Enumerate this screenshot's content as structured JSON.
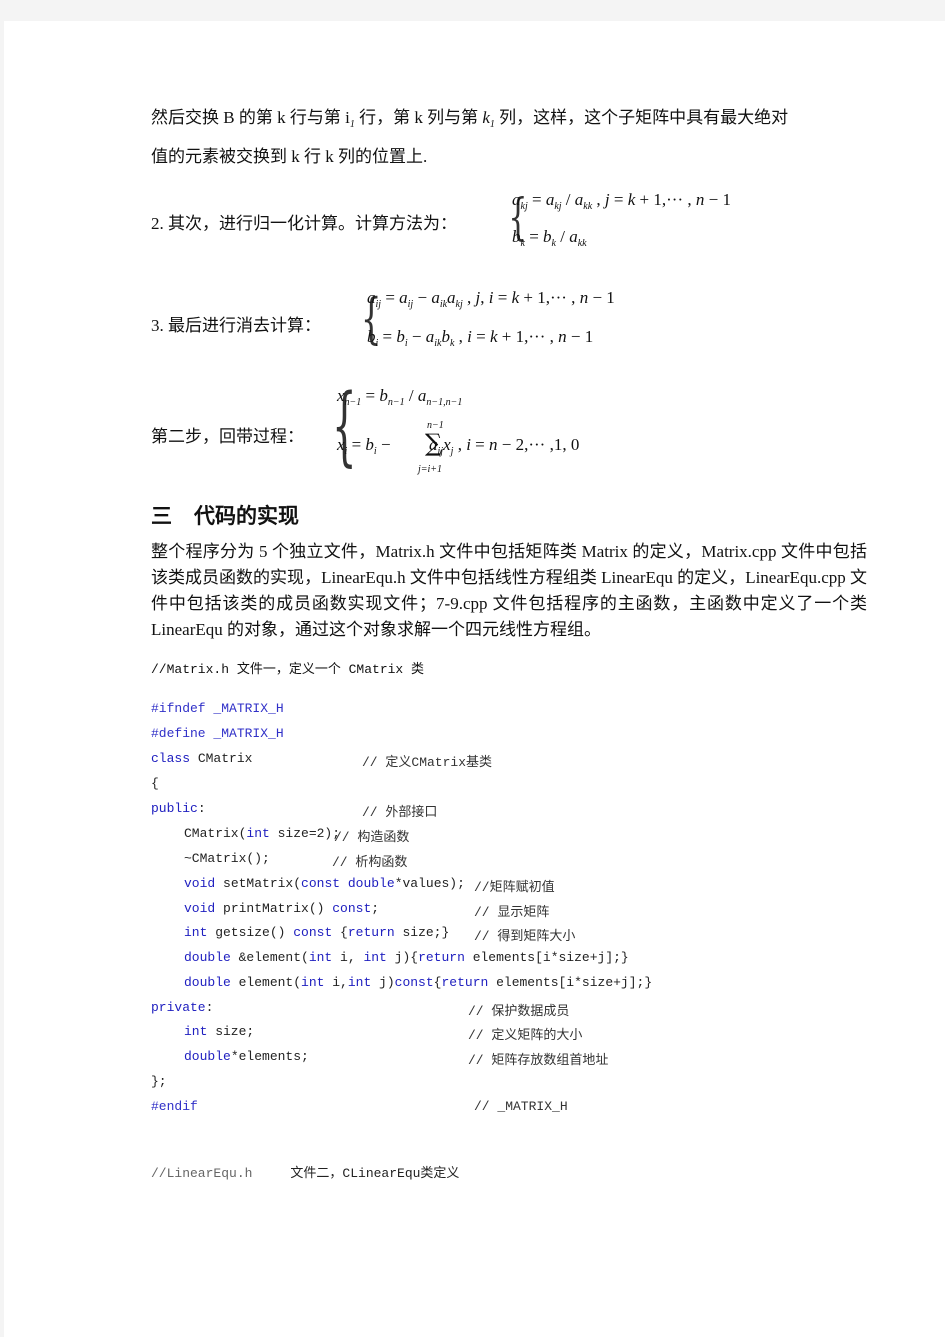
{
  "intro_paragraph": {
    "line1_a": "然后交换 B 的第 k 行与第 ",
    "i1_base": "i",
    "i1_sub": "1",
    "line1_b": " 行，第 k 列与第 ",
    "k1_base": "k",
    "k1_sub": "1",
    "line1_c": " 列，这样，这个子矩阵中具有最大绝对",
    "line2": "值的元素被交换到 k 行 k 列的位置上."
  },
  "step2": {
    "label": "2.  其次，进行归一化计算。计算方法为：",
    "eq1": "a_kj = a_kj / a_kk , j = k + 1,··· , n − 1",
    "eq2": "b_k = b_k / a_kk"
  },
  "step3": {
    "label": "3.  最后进行消去计算：",
    "eq1": "a_ij = a_ij − a_ik a_kj , j, i = k + 1,··· , n − 1",
    "eq2": "b_i = b_i − a_ik b_k , i = k + 1,··· , n − 1"
  },
  "back_substitution": {
    "label": "第二步，回带过程：",
    "eq1": "x_{n−1} = b_{n−1} / a_{n−1,n−1}",
    "eq2": "x_i = b_i − Σ_{j=i+1}^{n−1} a_ij x_j , i = n − 2,··· ,1, 0",
    "sum_upper": "n−1",
    "sum_lower": "j=i+1"
  },
  "section3": {
    "heading_num": "三",
    "heading_text": "代码的实现",
    "paragraph": "整个程序分为 5 个独立文件，Matrix.h 文件中包括矩阵类 Matrix 的定义，Matrix.cpp 文件中包括该类成员函数的实现，LinearEqu.h 文件中包括线性方程组类 LinearEqu 的定义，LinearEqu.cpp 文件中包括该类的成员函数实现文件；7-9.cpp 文件包括程序的主函数，主函数中定义了一个类 LinearEqu 的对象，通过这个对象求解一个四元线性方程组。"
  },
  "code": {
    "file1_header": "//Matrix.h 文件一，定义一个 CMatrix 类",
    "lines": [
      {
        "code": "#ifndef _MATRIX_H",
        "comment": ""
      },
      {
        "code": "#define _MATRIX_H",
        "comment": ""
      },
      {
        "code": "class CMatrix",
        "comment": "// 定义CMatrix基类"
      },
      {
        "code": "{",
        "comment": ""
      },
      {
        "code": "public:",
        "comment": "// 外部接口"
      },
      {
        "code": "CMatrix(int size=2);",
        "comment": "// 构造函数"
      },
      {
        "code": "~CMatrix();",
        "comment": "// 析构函数"
      },
      {
        "code": "void setMatrix(const double*values);",
        "comment": "//矩阵赋初值"
      },
      {
        "code": "void printMatrix()  const;",
        "comment": "// 显示矩阵"
      },
      {
        "code": "int getsize() const {return size;}",
        "comment": "// 得到矩阵大小"
      },
      {
        "code": "double &element(int i, int j){return elements[i*size+j];}",
        "comment": ""
      },
      {
        "code": "double element(int i,int j)const{return elements[i*size+j];}",
        "comment": ""
      },
      {
        "code": "private:",
        "comment": "// 保护数据成员"
      },
      {
        "code": "int size;",
        "comment": "// 定义矩阵的大小"
      },
      {
        "code": "double*elements;",
        "comment": "// 矩阵存放数组首地址"
      },
      {
        "code": "};",
        "comment": ""
      },
      {
        "code": "#endif",
        "comment": "// _MATRIX_H"
      }
    ],
    "file2_header_a": "//LinearEqu.h",
    "file2_header_b": "文件二，CLinearEqu类定义"
  },
  "colors": {
    "page_background": "#ffffff",
    "outer_background": "#f4f4f4",
    "code_keyword": "#2020c0",
    "text": "#111111"
  }
}
